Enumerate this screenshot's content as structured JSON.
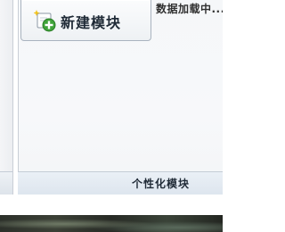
{
  "status": {
    "loading_text": "数据加载中..."
  },
  "toolbar": {
    "new_module_label": "新建模块",
    "new_module_icon": "add-module-icon"
  },
  "footer": {
    "custom_module_label": "个性化模块"
  },
  "colors": {
    "panel_background": "#f5f7f9",
    "border": "#a9b3bf",
    "add_icon_green": "#3fa33a",
    "sparkle_yellow": "#f2c21b"
  }
}
